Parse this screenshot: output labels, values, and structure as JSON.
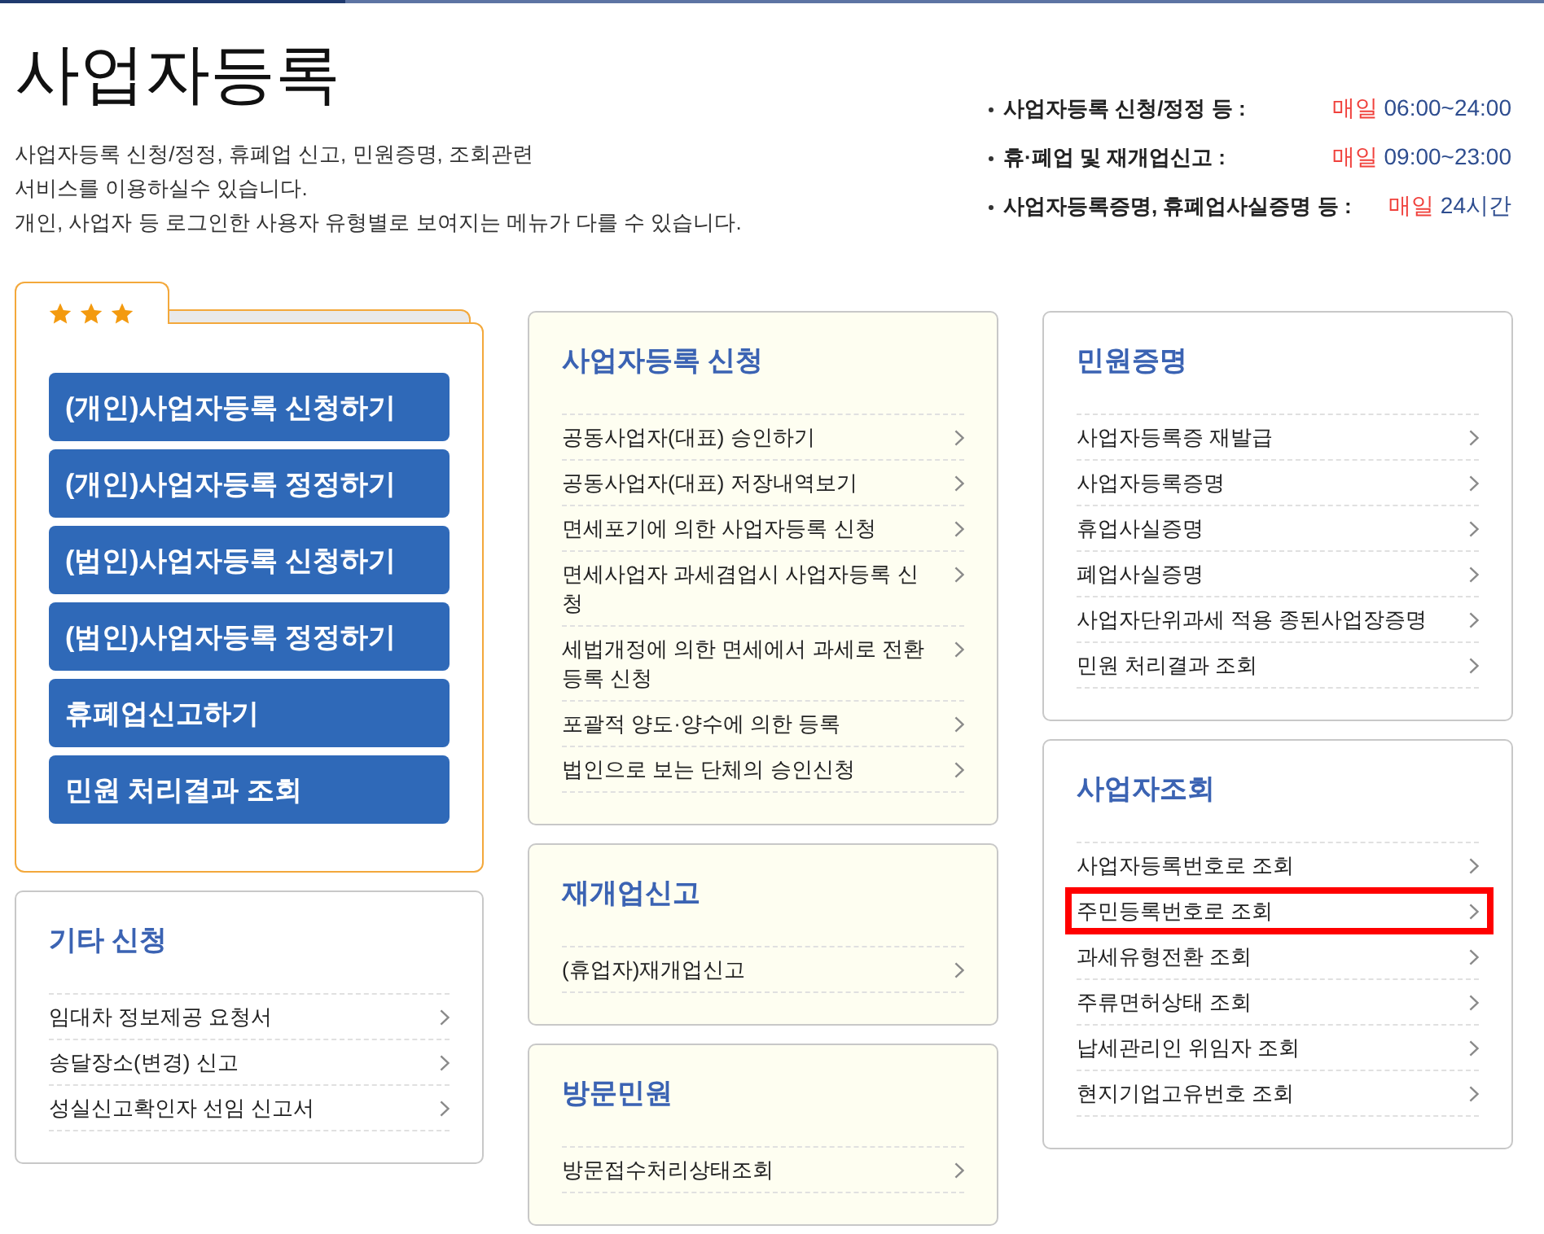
{
  "header": {
    "title": "사업자등록",
    "description": [
      "사업자등록 신청/정정, 휴폐업 신고, 민원증명, 조회관련",
      "서비스를 이용하실수 있습니다.",
      "개인, 사업자 등 로그인한 사용자 유형별로 보여지는 메뉴가 다를 수 있습니다."
    ],
    "hours": [
      {
        "label": "사업자등록 신청/정정 등 :",
        "day": "매일",
        "time": "06:00~24:00"
      },
      {
        "label": "휴·폐업 및 재개업신고 :",
        "day": "매일",
        "time": "09:00~23:00"
      },
      {
        "label": "사업자등록증명, 휴폐업사실증명 등 :",
        "day": "매일",
        "time": "24시간"
      }
    ]
  },
  "favorites": {
    "buttons": [
      "(개인)사업자등록 신청하기",
      "(개인)사업자등록 정정하기",
      "(법인)사업자등록 신청하기",
      "(법인)사업자등록 정정하기",
      "휴폐업신고하기",
      "민원 처리결과 조회"
    ]
  },
  "other_requests": {
    "title": "기타 신청",
    "items": [
      {
        "label": "임대차 정보제공 요청서"
      },
      {
        "label": "송달장소(변경) 신고"
      },
      {
        "label": "성실신고확인자 선임 신고서"
      }
    ]
  },
  "middle_panels": [
    {
      "title": "사업자등록 신청",
      "items": [
        {
          "label": "공동사업자(대표) 승인하기"
        },
        {
          "label": "공동사업자(대표) 저장내역보기"
        },
        {
          "label": "면세포기에 의한 사업자등록 신청"
        },
        {
          "label": "면세사업자 과세겸업시 사업자등록 신청"
        },
        {
          "label": "세법개정에 의한 면세에서 과세로 전환 등록 신청"
        },
        {
          "label": "포괄적 양도·양수에 의한 등록"
        },
        {
          "label": "법인으로 보는 단체의 승인신청"
        }
      ]
    },
    {
      "title": "재개업신고",
      "items": [
        {
          "label": "(휴업자)재개업신고"
        }
      ]
    },
    {
      "title": "방문민원",
      "items": [
        {
          "label": "방문접수처리상태조회"
        }
      ]
    }
  ],
  "right_panels": [
    {
      "title": "민원증명",
      "items": [
        {
          "label": "사업자등록증 재발급"
        },
        {
          "label": "사업자등록증명"
        },
        {
          "label": "휴업사실증명"
        },
        {
          "label": "폐업사실증명"
        },
        {
          "label": "사업자단위과세 적용 종된사업장증명"
        },
        {
          "label": "민원 처리결과 조회"
        }
      ]
    },
    {
      "title": "사업자조회",
      "items": [
        {
          "label": "사업자등록번호로 조회",
          "highlighted": false
        },
        {
          "label": "주민등록번호로 조회",
          "highlighted": true
        },
        {
          "label": "과세유형전환 조회",
          "highlighted": false
        },
        {
          "label": "주류면허상태 조회",
          "highlighted": false
        },
        {
          "label": "납세관리인 위임자 조회",
          "highlighted": false
        },
        {
          "label": "현지기업고유번호 조회",
          "highlighted": false
        }
      ]
    }
  ]
}
